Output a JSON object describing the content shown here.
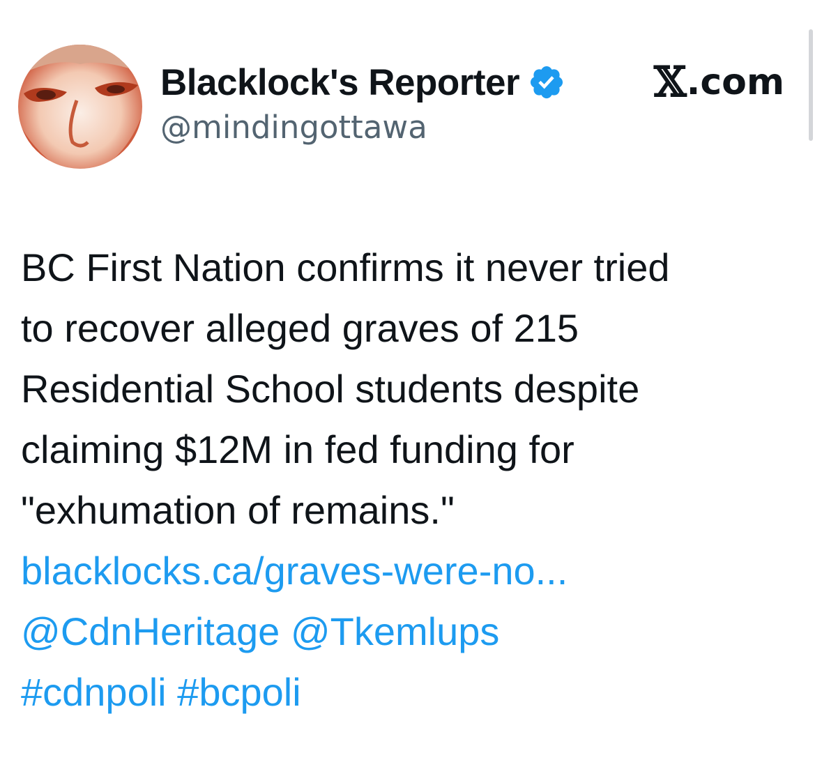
{
  "author": {
    "display_name": "Blacklock's Reporter",
    "handle": "@mindingottawa",
    "verified": true,
    "avatar_icon": "profile-photo"
  },
  "brand": {
    "logo_letter": "𝕏",
    "label": ".com"
  },
  "tweet": {
    "text_lines": [
      "BC First Nation confirms it never tried",
      "to recover alleged graves of 215",
      "Residential School students despite",
      "claiming $12M in fed funding for",
      "\"exhumation of remains.\""
    ],
    "link": "blacklocks.ca/graves-were-no...",
    "mentions": [
      "@CdnHeritage",
      "@Tkemlups"
    ],
    "hashtags": [
      "#cdnpoli",
      "#bcpoli"
    ]
  },
  "colors": {
    "text": "#0f1419",
    "secondary": "#536471",
    "link": "#1d9bf0",
    "verified_badge": "#1d9bf0"
  }
}
